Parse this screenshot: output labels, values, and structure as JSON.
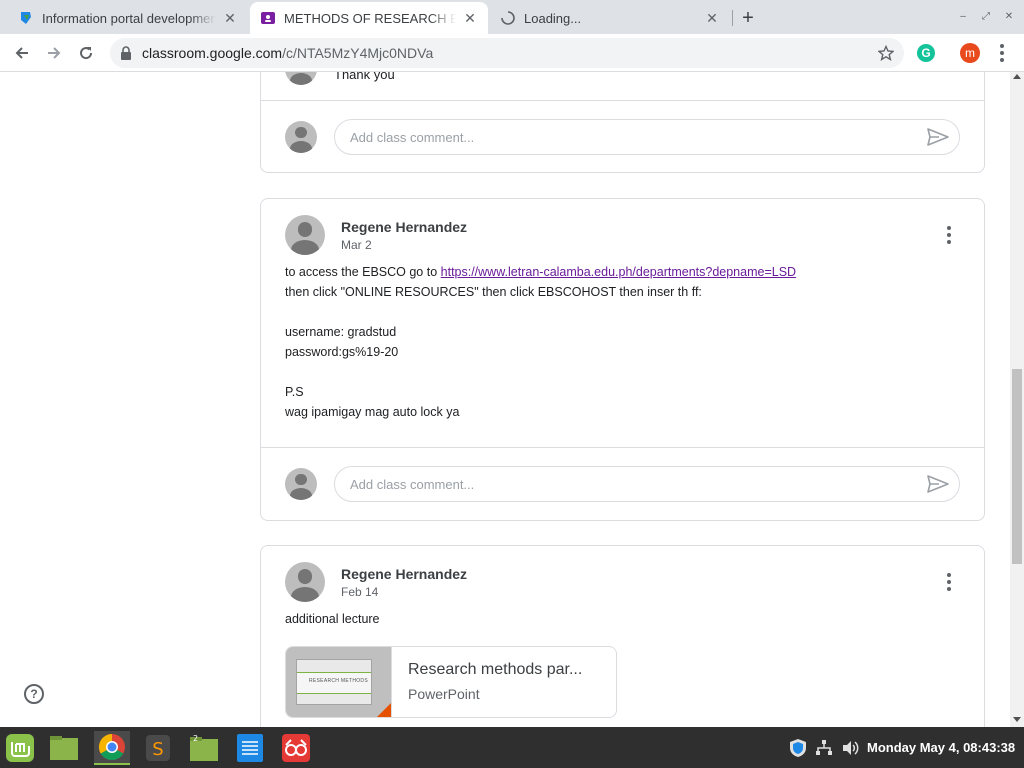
{
  "browser": {
    "tabs": [
      {
        "title": "Information portal development",
        "icon": "portal-favicon-icon"
      },
      {
        "title": "METHODS OF RESEARCH BSIT",
        "icon": "classroom-favicon-icon"
      },
      {
        "title": "Loading...",
        "icon": "loading-spinner-icon"
      }
    ],
    "url_host": "classroom.google.com",
    "url_path": "/c/NTA5MzY4Mjc0NDVa",
    "extension_label": "G",
    "profile_initial": "m"
  },
  "stream": {
    "comment_placeholder": "Add class comment...",
    "previous_comment_text": "Thank you",
    "posts": [
      {
        "author": "Regene Hernandez",
        "date": "Mar 2",
        "line1_prefix": "to access the EBSCO go to ",
        "link": "https://www.letran-calamba.edu.ph/departments?depname=LSD",
        "line2": "then click \"ONLINE RESOURCES\" then click EBSCOHOST then inser th ff:",
        "line3": "username: gradstud",
        "line4": "password:gs%19-20",
        "line5": "P.S",
        "line6": "wag ipamigay mag auto lock ya"
      },
      {
        "author": "Regene Hernandez",
        "date": "Feb 14",
        "text": "additional lecture",
        "attachment": {
          "title": "Research methods par...",
          "type": "PowerPoint",
          "thumb_text": "RESEARCH METHODS"
        }
      }
    ]
  },
  "taskbar": {
    "clock": "Monday May 4, 08:43:38",
    "files_badge": "2"
  }
}
